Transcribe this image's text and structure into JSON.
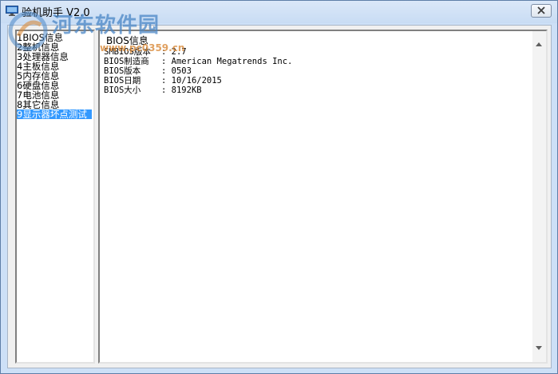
{
  "window": {
    "title": "验机助手 V2.0",
    "close_glyph": "✕"
  },
  "watermark": {
    "name": "河东软件园",
    "url": "www.pc0359.cn"
  },
  "tree": {
    "items": [
      {
        "label": "1BIOS信息",
        "selected": false
      },
      {
        "label": "2整机信息",
        "selected": false
      },
      {
        "label": "3处理器信息",
        "selected": false
      },
      {
        "label": "4主板信息",
        "selected": false
      },
      {
        "label": "5内存信息",
        "selected": false
      },
      {
        "label": "6硬盘信息",
        "selected": false
      },
      {
        "label": "7电池信息",
        "selected": false
      },
      {
        "label": "8其它信息",
        "selected": false
      },
      {
        "label": "9显示器坏点测试",
        "selected": true
      }
    ]
  },
  "content": {
    "section_title": "BIOS信息",
    "rows": [
      {
        "label": "SMBIOS版本",
        "sep": ":",
        "value": "2.7"
      },
      {
        "label": "BIOS制造商",
        "sep": ":",
        "value": "American Megatrends Inc."
      },
      {
        "label": "BIOS版本",
        "sep": ":",
        "value": "0503"
      },
      {
        "label": "BIOS日期",
        "sep": ":",
        "value": "10/16/2015"
      },
      {
        "label": "BIOS大小",
        "sep": ":",
        "value": "8192KB"
      }
    ]
  },
  "colors": {
    "selection": "#3399ff",
    "titlebar": "#cde0f7",
    "watermark_blue": "#4a86c6",
    "watermark_orange": "#d98a3a"
  },
  "icons": {
    "app": "monitor-icon",
    "close": "close-icon",
    "scroll_up": "arrow-up-icon",
    "scroll_down": "arrow-down-icon"
  }
}
